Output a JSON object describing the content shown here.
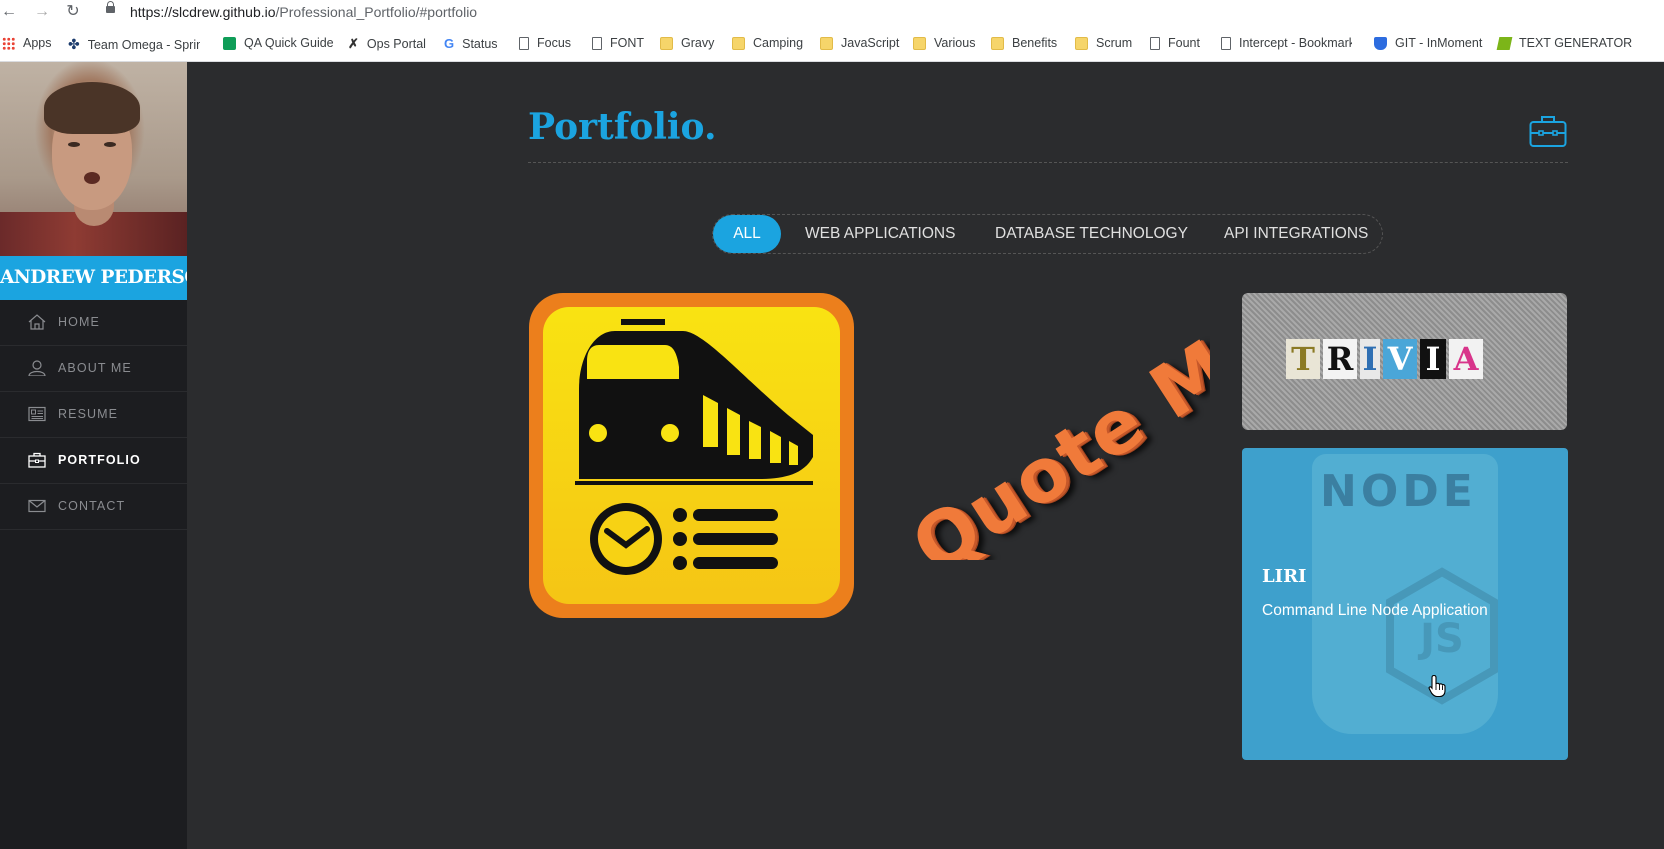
{
  "browser": {
    "url_host": "https://slcdrew.github.io",
    "url_path": "/Professional_Portfolio/#portfolio",
    "bookmarks": [
      {
        "label": "Apps",
        "icon": "apps-grid-icon"
      },
      {
        "label": "Team Omega - Sprint",
        "icon": "team-icon"
      },
      {
        "label": "QA Quick Guide",
        "icon": "sheets-icon"
      },
      {
        "label": "Ops Portal",
        "icon": "x-logo-icon"
      },
      {
        "label": "Status",
        "icon": "google-icon"
      },
      {
        "label": "Focus",
        "icon": "page-icon"
      },
      {
        "label": "FONT",
        "icon": "page-icon"
      },
      {
        "label": "Gravy",
        "icon": "folder-icon"
      },
      {
        "label": "Camping",
        "icon": "folder-icon"
      },
      {
        "label": "JavaScript",
        "icon": "folder-icon"
      },
      {
        "label": "Various",
        "icon": "folder-icon"
      },
      {
        "label": "Benefits",
        "icon": "folder-icon"
      },
      {
        "label": "Scrum",
        "icon": "folder-icon"
      },
      {
        "label": "Fount",
        "icon": "page-icon"
      },
      {
        "label": "Intercept - Bookmark",
        "icon": "page-icon"
      },
      {
        "label": "GIT - InMoment",
        "icon": "shield-icon"
      },
      {
        "label": "TEXT GENERATOR",
        "icon": "text-generator-icon"
      }
    ]
  },
  "sidebar": {
    "name": "ANDREW PEDERSON",
    "items": [
      {
        "label": "HOME",
        "icon": "home-icon",
        "active": false
      },
      {
        "label": "ABOUT ME",
        "icon": "person-icon",
        "active": false
      },
      {
        "label": "RESUME",
        "icon": "resume-icon",
        "active": false
      },
      {
        "label": "PORTFOLIO",
        "icon": "briefcase-icon",
        "active": true
      },
      {
        "label": "CONTACT",
        "icon": "envelope-icon",
        "active": false
      }
    ]
  },
  "main": {
    "title": "Portfolio.",
    "filters": [
      "ALL",
      "WEB APPLICATIONS",
      "DATABASE TECHNOLOGY",
      "API INTEGRATIONS"
    ],
    "active_filter": "ALL",
    "projects": {
      "quote_text": "Quote Me",
      "trivia_letters": [
        "T",
        "R",
        "I",
        "V",
        "I",
        "A"
      ],
      "liri_bg_word": "NODE",
      "liri_title": "LIRI",
      "liri_subtitle": "Command Line Node Application"
    }
  },
  "colors": {
    "accent": "#1ba4e0",
    "sidebar_bg": "#1c1d20",
    "main_bg": "#2b2c2e"
  }
}
